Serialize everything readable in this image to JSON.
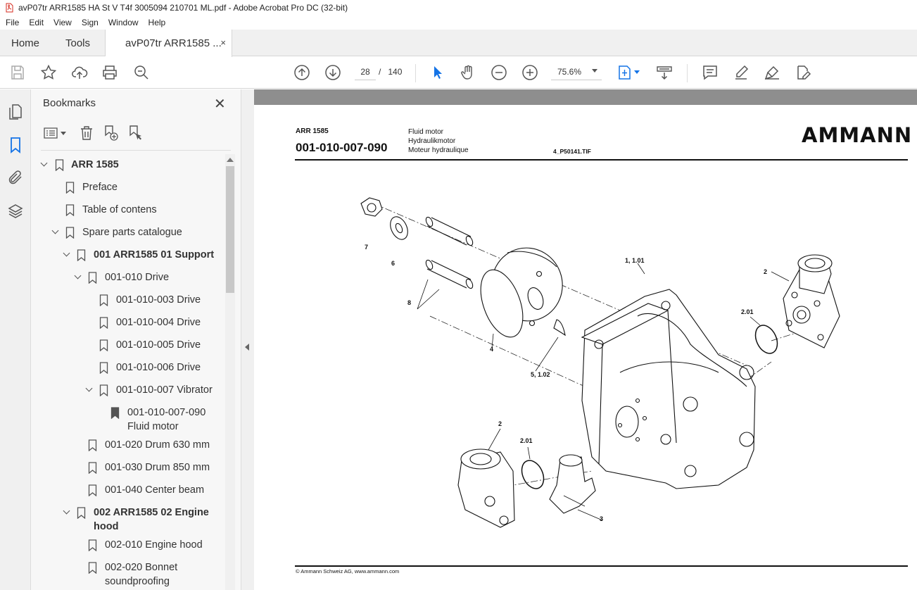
{
  "window": {
    "title": "avP07tr ARR1585 HA St V T4f 3005094 210701 ML.pdf - Adobe Acrobat Pro DC (32-bit)"
  },
  "menu": [
    "File",
    "Edit",
    "View",
    "Sign",
    "Window",
    "Help"
  ],
  "tabs": {
    "home": "Home",
    "tools": "Tools",
    "document": "avP07tr ARR1585 ...",
    "close_glyph": "×"
  },
  "toolbar": {
    "current_page": "28",
    "page_separator": "/",
    "total_pages": "140",
    "zoom": "75.6%"
  },
  "bookmarks": {
    "title": "Bookmarks",
    "close_glyph": "✕",
    "items": [
      {
        "label": "ARR 1585",
        "bold": true
      },
      {
        "label": "Preface",
        "bold": false
      },
      {
        "label": "Table of contens",
        "bold": false
      },
      {
        "label": "Spare parts catalogue",
        "bold": false
      },
      {
        "label": "001 ARR1585 01 Support",
        "bold": true
      },
      {
        "label": "001-010 Drive",
        "bold": false
      },
      {
        "label": "001-010-003 Drive",
        "bold": false
      },
      {
        "label": "001-010-004 Drive",
        "bold": false
      },
      {
        "label": "001-010-005 Drive",
        "bold": false
      },
      {
        "label": "001-010-006 Drive",
        "bold": false
      },
      {
        "label": "001-010-007 Vibrator",
        "bold": false
      },
      {
        "label": "001-010-007-090",
        "label2": "Fluid motor",
        "bold": false,
        "selected": true
      },
      {
        "label": "001-020 Drum 630 mm",
        "bold": false
      },
      {
        "label": "001-030 Drum 850 mm",
        "bold": false
      },
      {
        "label": "001-040 Center beam",
        "bold": false
      },
      {
        "label": "002 ARR1585 02 Engine",
        "label2": "hood",
        "bold": true
      },
      {
        "label": "002-010 Engine hood",
        "bold": false
      },
      {
        "label": "002-020 Bonnet",
        "label2": "soundproofing",
        "bold": false
      }
    ]
  },
  "document": {
    "model": "ARR 1585",
    "part_code": "001-010-007-090",
    "desc_en": "Fluid motor",
    "desc_de": "Hydraulikmotor",
    "desc_fr": "Moteur hydraulique",
    "file_ref": "4_P50141.TIF",
    "logo": "AMMANN",
    "footer": "© Ammann Schweiz AG, www.ammann.com",
    "callouts": {
      "c7": "7",
      "c6": "6",
      "c8": "8",
      "c4": "4",
      "c5": "5, 1.02",
      "c1": "1, 1.01",
      "c2a": "2",
      "c201a": "2.01",
      "c2b": "2",
      "c201b": "2.01",
      "c3": "3"
    }
  },
  "colors": {
    "accent": "#1473e6",
    "chrome_bg": "#f0f0f0",
    "doc_bg": "#8e8e8e"
  }
}
